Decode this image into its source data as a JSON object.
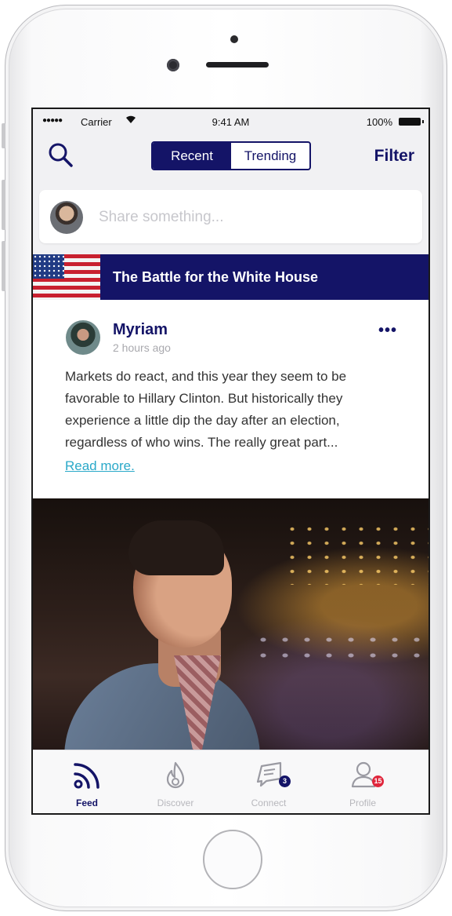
{
  "status_bar": {
    "signal": "●●●●●",
    "carrier": "Carrier",
    "wifi_icon": "wifi-icon",
    "time": "9:41 AM",
    "battery": "100%"
  },
  "nav": {
    "search_icon": "search-icon",
    "tabs": [
      {
        "label": "Recent",
        "active": true
      },
      {
        "label": "Trending",
        "active": false
      }
    ],
    "filter_label": "Filter"
  },
  "compose": {
    "placeholder": "Share something..."
  },
  "banner": {
    "title": "The Battle for the White House"
  },
  "post": {
    "author": "Myriam",
    "time": "2 hours ago",
    "more_label": "•••",
    "body": "Markets do react, and this year they seem to be favorable to Hillary Clinton. But historically they experience a little dip the day after an election, regardless of who wins. The really great part...",
    "read_more": "Read more."
  },
  "tabbar": {
    "items": [
      {
        "label": "Feed",
        "icon": "feed-icon",
        "active": true
      },
      {
        "label": "Discover",
        "icon": "flame-icon",
        "active": false
      },
      {
        "label": "Connect",
        "icon": "chat-icon",
        "badge": "3",
        "active": false
      },
      {
        "label": "Profile",
        "icon": "profile-icon",
        "badge": "15",
        "active": false
      }
    ]
  },
  "colors": {
    "brand_navy": "#141467",
    "link_cyan": "#2aa9c9",
    "badge_red": "#e0263c"
  }
}
